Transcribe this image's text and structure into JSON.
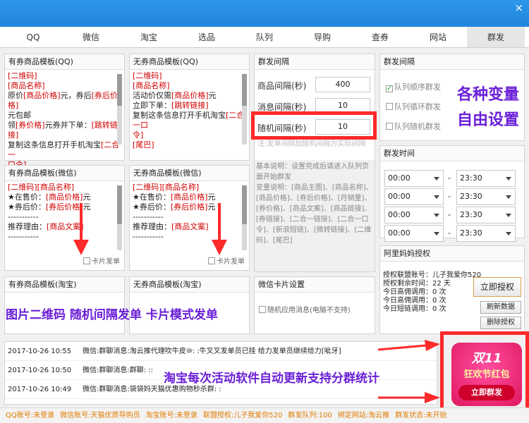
{
  "window": {
    "close_glyph": "×"
  },
  "tabs": [
    {
      "label": "QQ"
    },
    {
      "label": "微信"
    },
    {
      "label": "淘宝"
    },
    {
      "label": "选品"
    },
    {
      "label": "队列"
    },
    {
      "label": "导购"
    },
    {
      "label": "查券"
    },
    {
      "label": "网站"
    },
    {
      "label": "群发",
      "active": true
    }
  ],
  "templates": {
    "qq_coupon": {
      "title": "有券商品模板(QQ)",
      "lines": [
        [
          {
            "t": "[二维码]",
            "red": true
          }
        ],
        [
          {
            "t": "[商品名称]",
            "red": true
          }
        ],
        [
          {
            "t": "原价"
          },
          {
            "t": "[商品价格]",
            "red": true
          },
          {
            "t": "元，券后"
          },
          {
            "t": "[券后价格]",
            "red": true
          }
        ],
        [
          {
            "t": "元包邮"
          }
        ],
        [
          {
            "t": "领"
          },
          {
            "t": "[券价格]",
            "red": true
          },
          {
            "t": "元券并下单："
          },
          {
            "t": "[跳转链接]",
            "red": true
          }
        ],
        [
          {
            "t": "复制这条信息打开手机淘宝"
          },
          {
            "t": "[二合一",
            "red": true
          }
        ],
        [
          {
            "t": "口令]",
            "red": true
          }
        ]
      ]
    },
    "qq_nocoupon": {
      "title": "无券商品模板(QQ)",
      "lines": [
        [
          {
            "t": "[二维码]",
            "red": true
          }
        ],
        [
          {
            "t": "[商品名称]",
            "red": true
          }
        ],
        [
          {
            "t": "活动价仅需"
          },
          {
            "t": "[商品价格]",
            "red": true
          },
          {
            "t": "元"
          }
        ],
        [
          {
            "t": "立即下单："
          },
          {
            "t": "[跳转链接]",
            "red": true
          }
        ],
        [
          {
            "t": "复制这条信息打开手机淘宝"
          },
          {
            "t": "[二合一口",
            "red": true
          }
        ],
        [
          {
            "t": "令]",
            "red": true
          }
        ],
        [
          {
            "t": "[尾巴]",
            "red": true
          }
        ]
      ]
    },
    "wx_coupon": {
      "title": "有券商品模板(微信)",
      "card_label": "卡片发单",
      "lines": [
        [
          {
            "t": "[二维码][商品名称]",
            "red": true
          }
        ],
        [
          {
            "t": " "
          }
        ],
        [
          {
            "t": "★在售价："
          },
          {
            "t": "[商品价格]",
            "red": true
          },
          {
            "t": "元"
          }
        ],
        [
          {
            "t": "★券后价："
          },
          {
            "t": "[券后价格]",
            "red": true
          },
          {
            "t": "元"
          }
        ],
        [
          {
            "t": "-----------"
          }
        ],
        [
          {
            "t": "推荐理由："
          },
          {
            "t": "[商品文案]",
            "red": true
          }
        ],
        [
          {
            "t": "-----------"
          }
        ]
      ]
    },
    "wx_nocoupon": {
      "title": "无券商品模板(微信)",
      "card_label": "卡片发单",
      "lines": [
        [
          {
            "t": "[二维码][商品名称]",
            "red": true
          }
        ],
        [
          {
            "t": " "
          }
        ],
        [
          {
            "t": "★在售价："
          },
          {
            "t": "[商品价格]",
            "red": true
          },
          {
            "t": "元"
          }
        ],
        [
          {
            "t": "★券后价："
          },
          {
            "t": "[券后价格]",
            "red": true
          },
          {
            "t": "元"
          }
        ],
        [
          {
            "t": "-----------"
          }
        ],
        [
          {
            "t": "推荐理由："
          },
          {
            "t": "[商品文案]",
            "red": true
          }
        ],
        [
          {
            "t": "-----------"
          }
        ]
      ]
    },
    "tb_coupon": {
      "title": "有券商品模板(淘宝)"
    },
    "tb_nocoupon": {
      "title": "无券商品模板(淘宝)"
    }
  },
  "interval": {
    "title": "群发间隔",
    "product_label": "商品间隔(秒)",
    "product_value": "400",
    "message_label": "消息间隔(秒)",
    "message_value": "10",
    "random_label": "随机间隔(秒)",
    "random_value": "10",
    "faded_hint": "注:发单间隔加随机间隔为实际间隔",
    "help": "基本说明：设置完成后请进入队列页面开始群发\n变量说明：[商品主图]、[商品名称]、[商品价格]、[券后价格]、[月销量]、[券价格]、[商品文案]、[商品链接]、[券链接]、[二合一链接]、[二合一口令]、[新浪短链]、[微转链接]、[二维码]、[尾巴]"
  },
  "sendmode": {
    "title": "群发间隔",
    "options": [
      {
        "label": "队列顺序群发",
        "checked": true
      },
      {
        "label": "队列循环群发",
        "checked": false
      },
      {
        "label": "队列随机群发",
        "checked": false
      }
    ]
  },
  "sendtime": {
    "title": "群发时间",
    "rows": [
      {
        "start": "00:00",
        "end": "23:30"
      },
      {
        "start": "00:00",
        "end": "23:30"
      },
      {
        "start": "00:00",
        "end": "23:30"
      },
      {
        "start": "00:00",
        "end": "23:30"
      }
    ],
    "sep": "-"
  },
  "wxcard": {
    "title": "微信卡片设置",
    "option": "随机应用消息(电脑不支持)"
  },
  "alimama": {
    "title": "阿里妈妈授权",
    "lines": [
      "授权联盟账号：儿子我爱你520",
      "授权剩余时间：22 天",
      "今日高佣调用：0 次",
      "今日高佣调用：0 次",
      "今日短链调用：0 次"
    ],
    "btn_auth": "立即授权",
    "btn_refresh": "刷新数据",
    "btn_delete": "删除授权"
  },
  "log": [
    {
      "time": "2017-10-26 10:55",
      "msg": "微信:群聊消息:淘云推代理吹牛皮⑩: :牛叉叉发单员已挂 给力发单员继续给力[呲牙]"
    },
    {
      "time": "2017-10-26 10:50",
      "msg": "微信:群聊消息:群聊: ::"
    },
    {
      "time": "2017-10-26 10:49",
      "msg": "微信:群聊消息:袋袋妈天猫优惠购物秒杀群: :"
    }
  ],
  "status": [
    "QQ账号:未登录",
    "微信账号:天猫优质导购员",
    "淘宝账号:未登录",
    "联盟授权:儿子我爱你520",
    "群发队列:100",
    "绑定网站:淘云推",
    "群发状态:未开始"
  ],
  "promo": {
    "line1": "双11",
    "line2": "狂欢节红包",
    "button": "立即群发"
  },
  "annotations": {
    "vars": "各种变量",
    "free": "自由设置",
    "features": "图片二维码  随机间隔发单  卡片模式发单",
    "auto": "淘宝每次活动软件自动更新支持分群统计"
  },
  "colors": {
    "accent": "#1f86dc",
    "overlay": "#6a1fd8",
    "highlight": "#ff2a2a",
    "red_text": "#d00000"
  }
}
